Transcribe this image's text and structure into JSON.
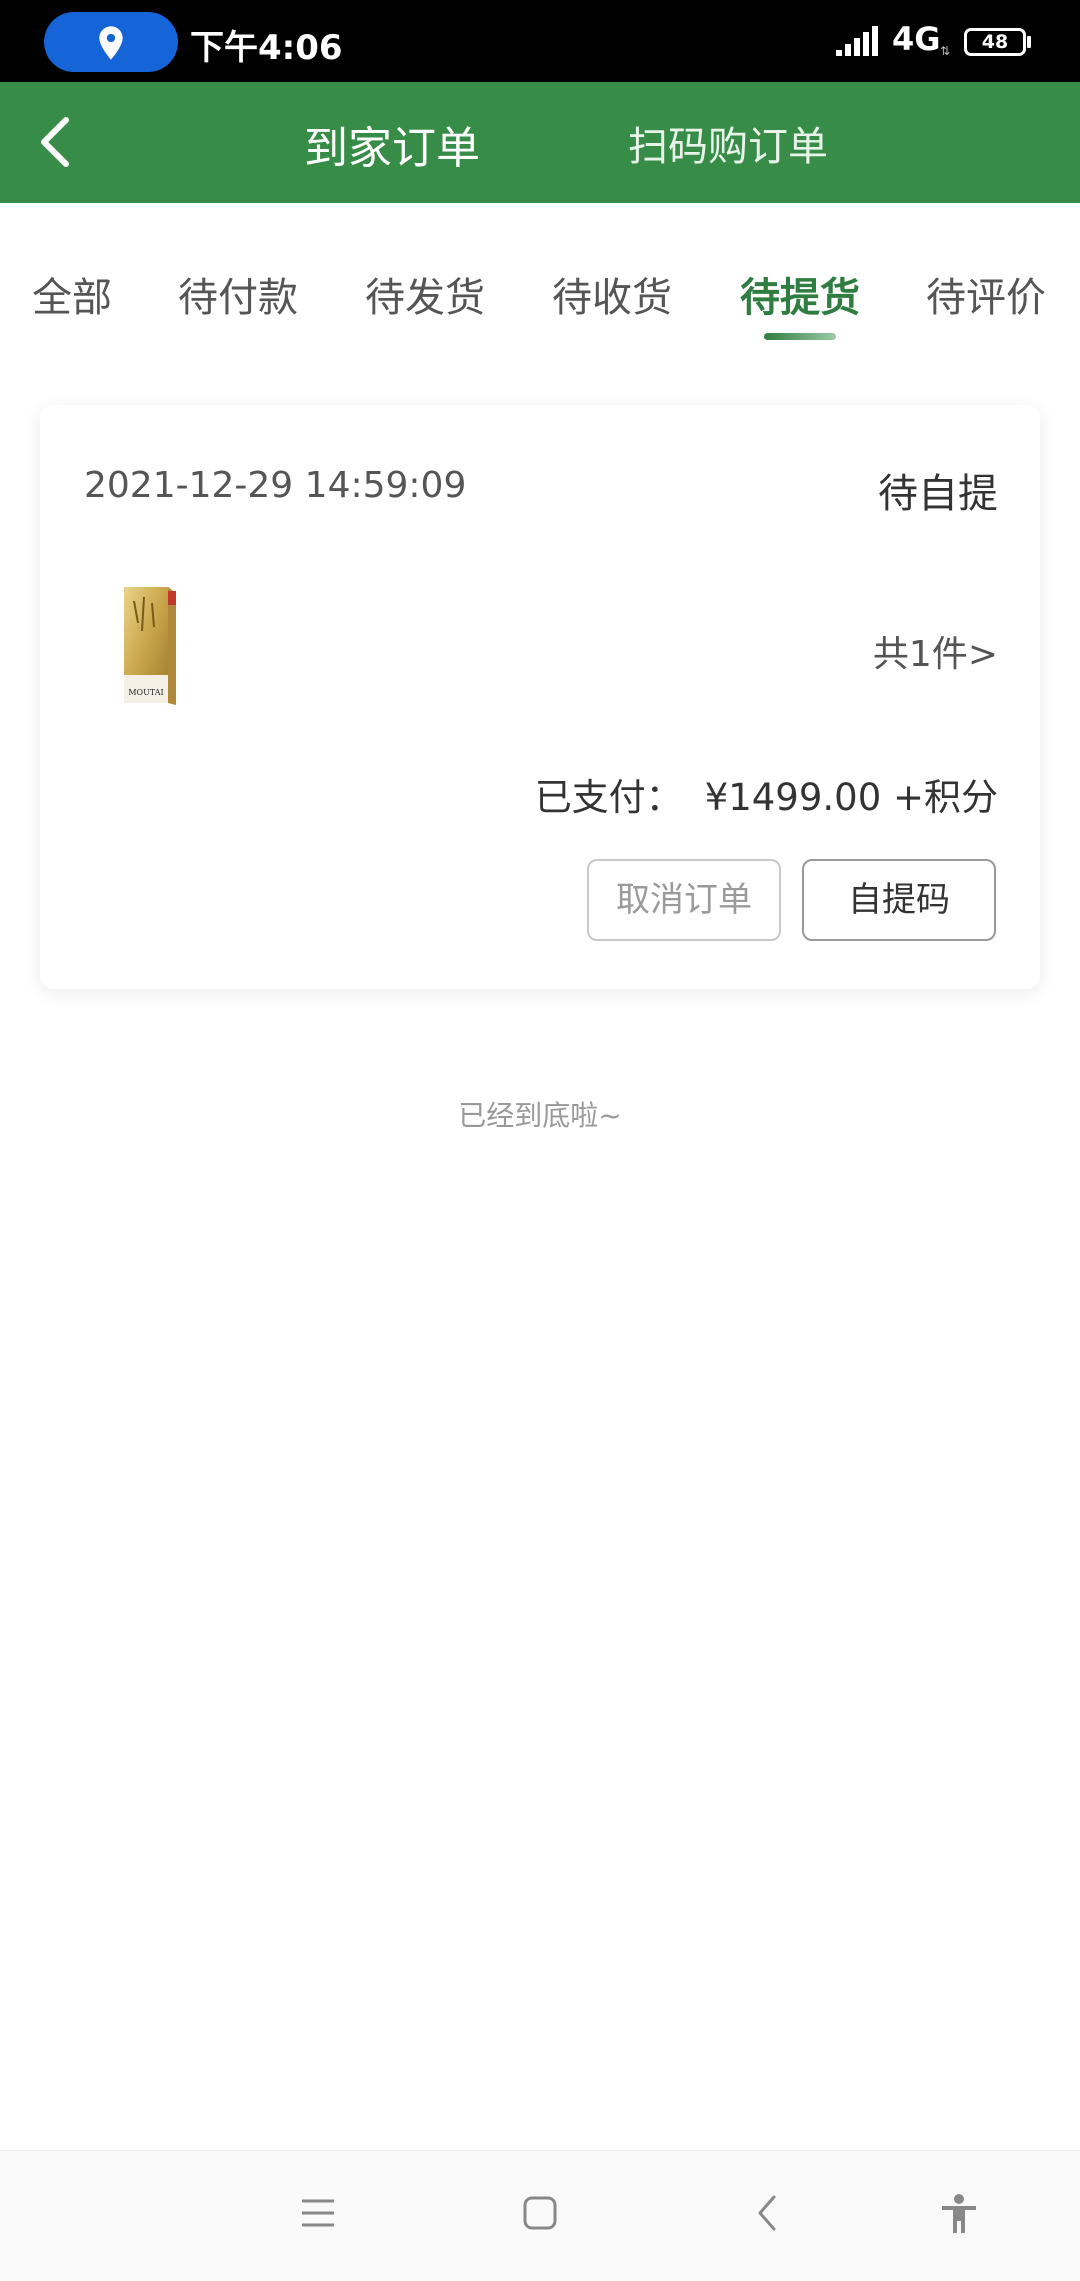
{
  "status_bar": {
    "time": "下午4:06",
    "network": "4G",
    "battery": "48"
  },
  "header": {
    "tabs": [
      {
        "label": "到家订单",
        "active": true
      },
      {
        "label": "扫码购订单",
        "active": false
      }
    ]
  },
  "order_tabs": [
    {
      "label": "全部"
    },
    {
      "label": "待付款"
    },
    {
      "label": "待发货"
    },
    {
      "label": "待收货"
    },
    {
      "label": "待提货",
      "active": true
    },
    {
      "label": "待评价"
    }
  ],
  "order": {
    "time": "2021-12-29 14:59:09",
    "status": "待自提",
    "count": "共1件>",
    "paid_label": "已支付：",
    "paid_amount": "¥1499.00 +积分",
    "product_brand": "MOUTAI",
    "buttons": {
      "cancel": "取消订单",
      "pickup_code": "自提码"
    }
  },
  "footer_text": "已经到底啦~",
  "colors": {
    "primary_green": "#378c47",
    "active_tab": "#2f7d40"
  },
  "icons": {
    "location": "location-pin-icon",
    "back": "chevron-left-icon",
    "menu": "menu-icon",
    "home": "home-square-icon",
    "nav_back": "back-arrow-icon",
    "accessibility": "accessibility-icon"
  }
}
